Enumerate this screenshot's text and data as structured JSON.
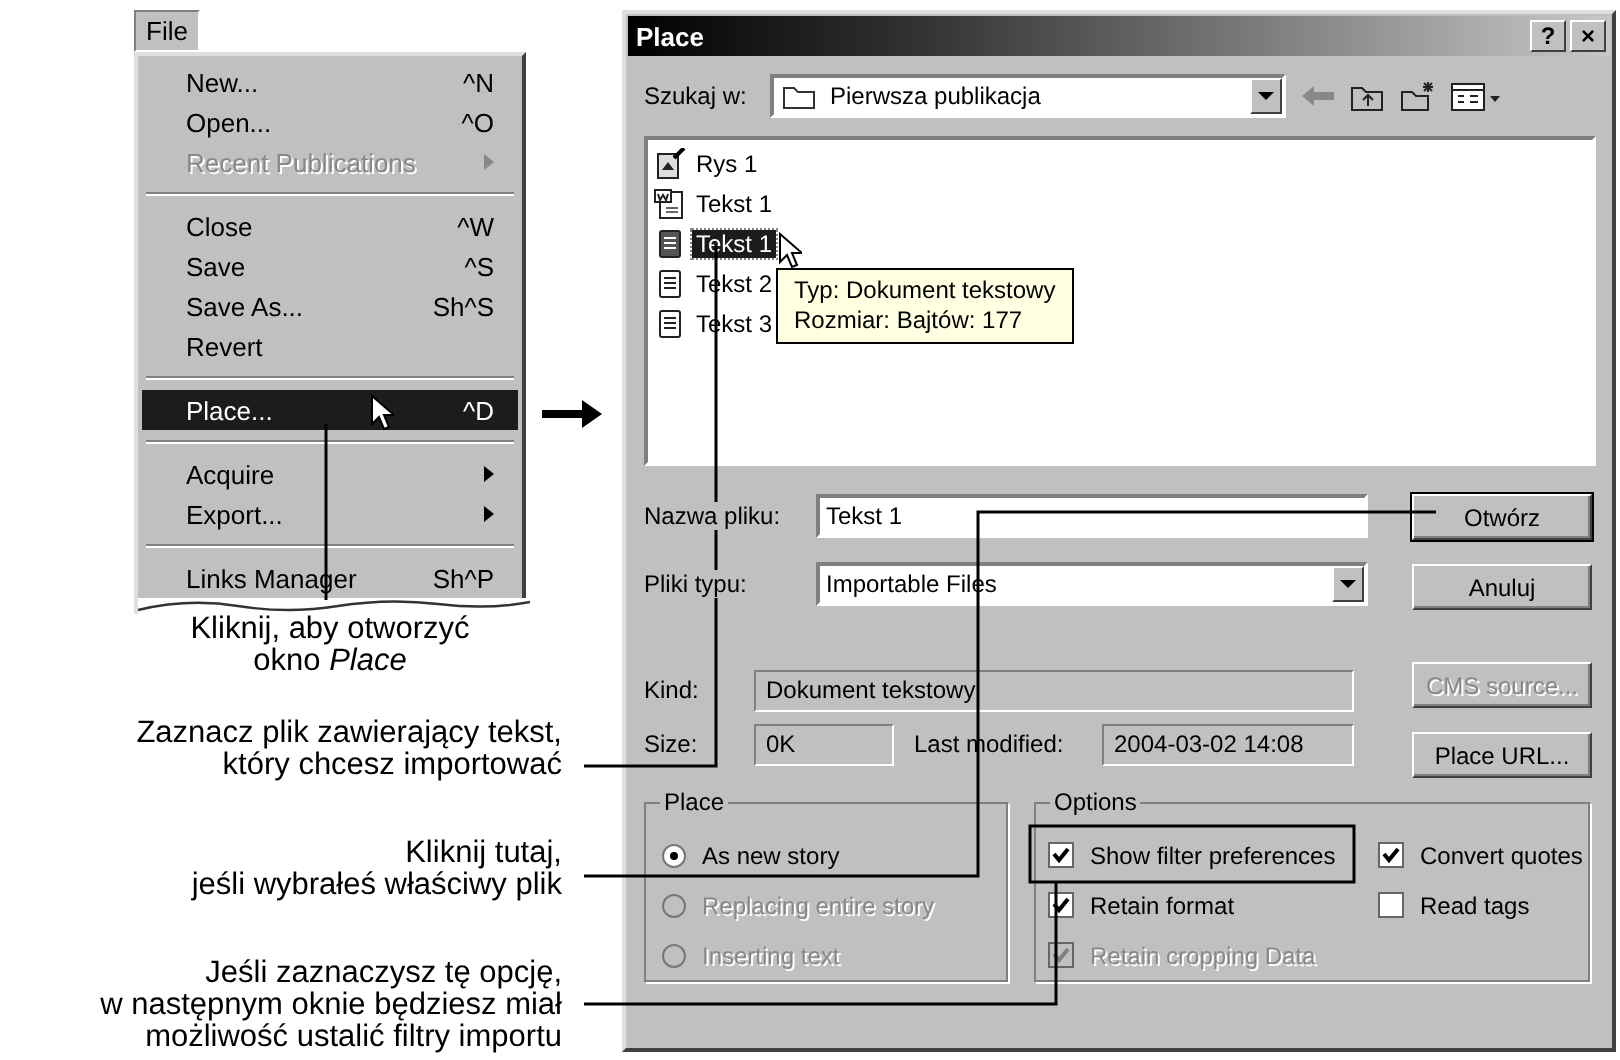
{
  "menu": {
    "title": "File",
    "items": [
      {
        "kind": "item",
        "label": "New...",
        "shortcut": "^N",
        "disabled": false,
        "selected": false,
        "submenu": false
      },
      {
        "kind": "item",
        "label": "Open...",
        "shortcut": "^O",
        "disabled": false,
        "selected": false,
        "submenu": false
      },
      {
        "kind": "item",
        "label": "Recent Publications",
        "disabled": true,
        "selected": false,
        "submenu": true
      },
      {
        "kind": "separator"
      },
      {
        "kind": "item",
        "label": "Close",
        "shortcut": "^W",
        "disabled": false,
        "selected": false,
        "submenu": false
      },
      {
        "kind": "item",
        "label": "Save",
        "shortcut": "^S",
        "disabled": false,
        "selected": false,
        "submenu": false
      },
      {
        "kind": "item",
        "label": "Save As...",
        "shortcut": "Sh^S",
        "disabled": false,
        "selected": false,
        "submenu": false
      },
      {
        "kind": "item",
        "label": "Revert",
        "disabled": false,
        "selected": false,
        "submenu": false
      },
      {
        "kind": "separator"
      },
      {
        "kind": "item",
        "label": "Place...",
        "shortcut": "^D",
        "disabled": false,
        "selected": true,
        "submenu": false
      },
      {
        "kind": "separator"
      },
      {
        "kind": "item",
        "label": "Acquire",
        "disabled": false,
        "selected": false,
        "submenu": true
      },
      {
        "kind": "item",
        "label": "Export...",
        "disabled": false,
        "selected": false,
        "submenu": true
      },
      {
        "kind": "separator"
      },
      {
        "kind": "item",
        "label": "Links Manager",
        "shortcut": "Sh^P",
        "disabled": false,
        "selected": false,
        "submenu": false
      }
    ]
  },
  "captions": [
    {
      "text": "Kliknij, aby otworzyć\nokno *Place*"
    },
    {
      "text": "Zaznacz plik zawierający tekst,\nktóry chcesz importować"
    },
    {
      "text": "Kliknij tutaj,\njeśli wybrałeś właściwy plik"
    },
    {
      "text": "Jeśli zaznaczysz tę opcję,\nw następnym oknie będziesz miał\nmożliwość ustalić filtry importu"
    }
  ],
  "dialog": {
    "title": "Place",
    "help": "?",
    "close": "×",
    "look_in": {
      "label": "Szukaj w:",
      "value": "Pierwsza publikacja"
    },
    "files": [
      {
        "name": "Rys 1",
        "kind": "image",
        "selected": false
      },
      {
        "name": "Tekst 1",
        "kind": "word",
        "selected": false
      },
      {
        "name": "Tekst 1",
        "kind": "text",
        "selected": true
      },
      {
        "name": "Tekst 2",
        "kind": "text",
        "selected": false
      },
      {
        "name": "Tekst 3",
        "kind": "text",
        "selected": false
      }
    ],
    "tooltip": [
      "Typ: Dokument tekstowy",
      "Rozmiar: Bajtów: 177"
    ],
    "file_name": {
      "label": "Nazwa pliku:",
      "value": "Tekst 1"
    },
    "file_type": {
      "label": "Pliki typu:",
      "value": "Importable Files"
    },
    "kind": {
      "label": "Kind:",
      "value": "Dokument tekstowy"
    },
    "size": {
      "label": "Size:",
      "value": "0K"
    },
    "modified": {
      "label": "Last modified:",
      "value": "2004-03-02 14:08"
    },
    "buttons": [
      {
        "label": "Otwórz",
        "disabled": false,
        "default": true
      },
      {
        "label": "Anuluj",
        "disabled": false,
        "default": false
      },
      {
        "label": "CMS source...",
        "disabled": true,
        "default": false
      },
      {
        "label": "Place URL...",
        "disabled": false,
        "default": false
      }
    ],
    "place_group": {
      "title": "Place",
      "options": [
        {
          "label": "As new story",
          "selected": true,
          "disabled": false
        },
        {
          "label": "Replacing entire story",
          "selected": false,
          "disabled": true
        },
        {
          "label": "Inserting text",
          "selected": false,
          "disabled": true
        }
      ]
    },
    "options_group": {
      "title": "Options",
      "checkboxes": [
        {
          "label": "Show filter preferences",
          "checked": true,
          "disabled": false
        },
        {
          "label": "Convert quotes",
          "checked": true,
          "disabled": false
        },
        {
          "label": "Retain format",
          "checked": true,
          "disabled": false
        },
        {
          "label": "Read tags",
          "checked": false,
          "disabled": false
        },
        {
          "label": "Retain cropping Data",
          "checked": true,
          "disabled": true
        }
      ]
    }
  }
}
